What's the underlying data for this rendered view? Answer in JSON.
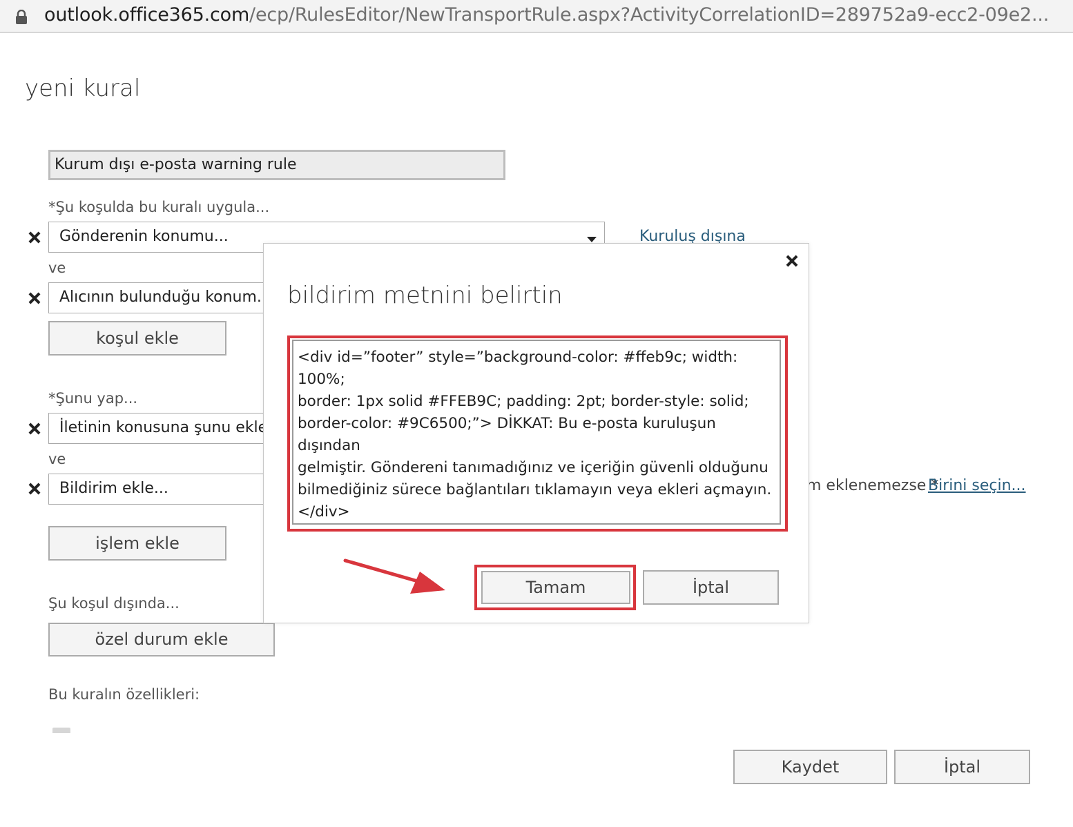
{
  "browser": {
    "url_host": "outlook.office365.com",
    "url_path": "/ecp/RulesEditor/NewTransportRule.aspx?ActivityCorrelationID=289752a9-ecc2-09e2..."
  },
  "page": {
    "title": "yeni kural",
    "rule_name": "Kurum dışı e-posta warning rule",
    "conditions_label": "*Şu koşulda bu kuralı uygula...",
    "condition_1": "Gönderenin konumu...",
    "condition_1_link": "Kuruluş dışına",
    "and_label_1": "ve",
    "condition_2": "Alıcının bulunduğu konum...",
    "add_condition": "koşul ekle",
    "actions_label": "*Şunu yap...",
    "action_1": "İletinin konusuna şunu ekle...",
    "and_label_2": "ve",
    "action_2": "Bildirim ekle...",
    "action_2_suffix": "m eklenemezse *",
    "action_2_link": "Birini seçin...",
    "add_action": "işlem ekle",
    "exceptions_label": "Şu koşul dışında...",
    "add_exception": "özel durum ekle",
    "properties_label": "Bu kuralın özellikleri:",
    "save": "Kaydet",
    "cancel": "İptal"
  },
  "dialog": {
    "title": "bildirim metnini belirtin",
    "notice_text": "<div id=”footer” style=”background-color: #ffeb9c; width: 100%;\nborder: 1px solid #FFEB9C; padding: 2pt; border-style: solid;\nborder-color: #9C6500;”> DİKKAT: Bu e-posta kuruluşun dışından\ngelmiştir. Göndereni tanımadığınız ve içeriğin güvenli olduğunu\nbilmediğiniz sürece bağlantıları tıklamayın veya ekleri açmayın.\n</div>",
    "ok": "Tamam",
    "cancel": "İptal"
  },
  "colors": {
    "highlight": "#d8363d",
    "link": "#2a5d7c"
  },
  "icons": [
    "lock-icon",
    "remove-icon",
    "close-icon",
    "dropdown-arrow-icon",
    "annotation-arrow"
  ]
}
